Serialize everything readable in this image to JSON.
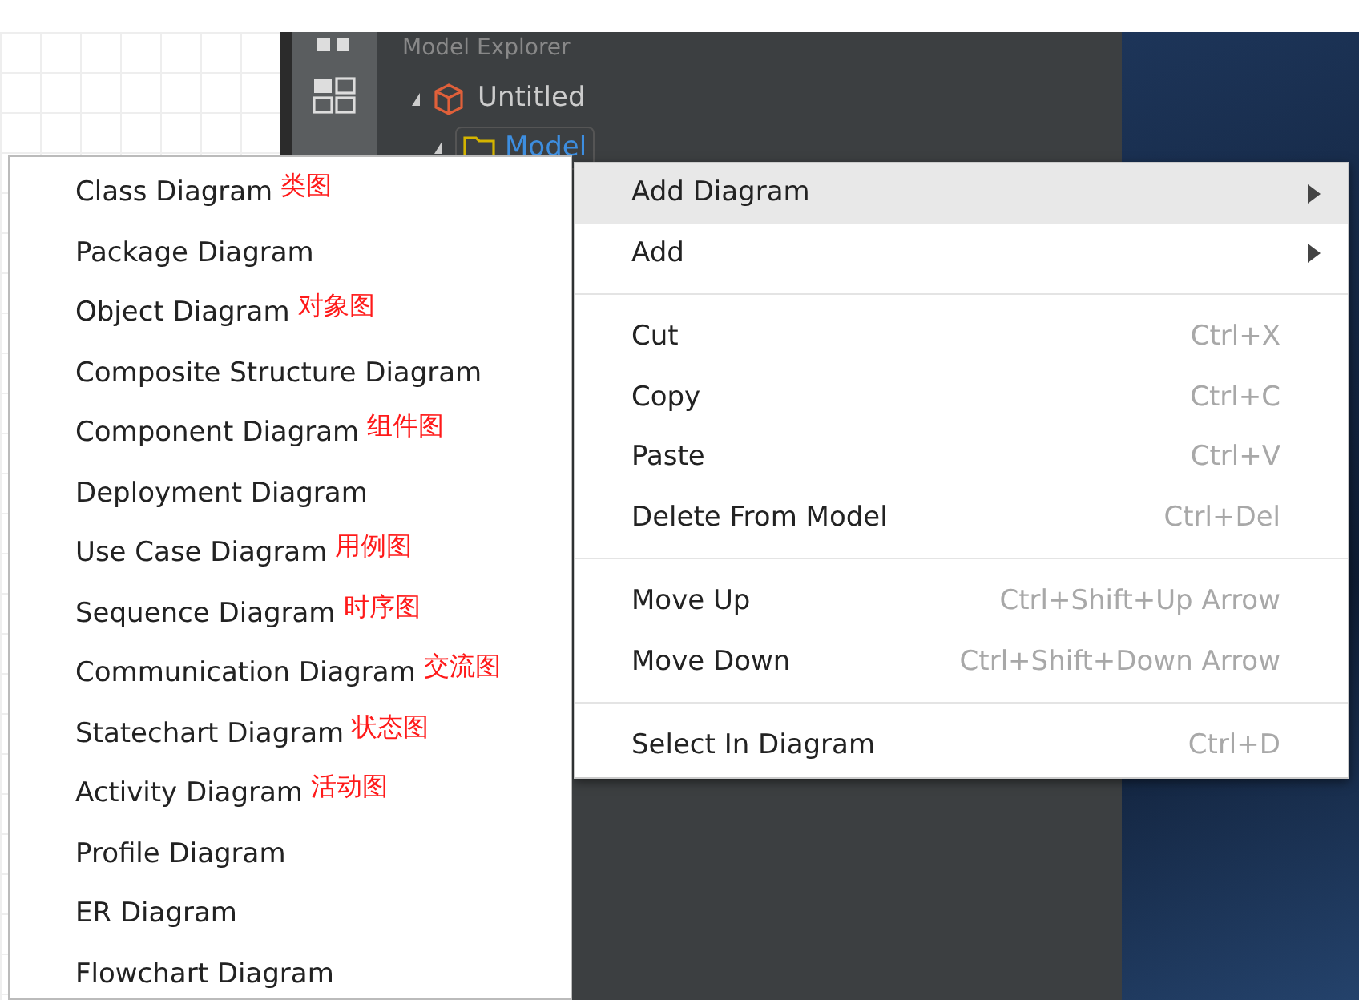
{
  "explorer": {
    "title": "Model Explorer",
    "tree": [
      {
        "label": "Untitled",
        "kind": "project",
        "expanded": true,
        "children": [
          {
            "label": "Model",
            "kind": "model",
            "expanded": true
          }
        ]
      }
    ]
  },
  "context_menu": {
    "items": [
      {
        "kind": "submenu",
        "label": "Add Diagram",
        "selected": true
      },
      {
        "kind": "submenu",
        "label": "Add",
        "selected": false
      },
      {
        "kind": "separator"
      },
      {
        "kind": "command",
        "label": "Cut",
        "shortcut": "Ctrl+X",
        "selected": false
      },
      {
        "kind": "command",
        "label": "Copy",
        "shortcut": "Ctrl+C",
        "selected": false
      },
      {
        "kind": "command",
        "label": "Paste",
        "shortcut": "Ctrl+V",
        "selected": false
      },
      {
        "kind": "command",
        "label": "Delete From Model",
        "shortcut": "Ctrl+Del",
        "selected": false
      },
      {
        "kind": "separator"
      },
      {
        "kind": "command",
        "label": "Move Up",
        "shortcut": "Ctrl+Shift+Up Arrow",
        "selected": false
      },
      {
        "kind": "command",
        "label": "Move Down",
        "shortcut": "Ctrl+Shift+Down Arrow",
        "selected": false
      },
      {
        "kind": "separator"
      },
      {
        "kind": "command",
        "label": "Select In Diagram",
        "shortcut": "Ctrl+D",
        "selected": false
      }
    ]
  },
  "submenu": {
    "items": [
      {
        "label": "Class Diagram",
        "note": "类图"
      },
      {
        "label": "Package Diagram"
      },
      {
        "label": "Object Diagram",
        "note": "对象图"
      },
      {
        "label": "Composite Structure Diagram"
      },
      {
        "label": "Component Diagram",
        "note": "组件图"
      },
      {
        "label": "Deployment Diagram"
      },
      {
        "label": "Use Case Diagram",
        "note": "用例图"
      },
      {
        "label": "Sequence Diagram",
        "note": "时序图"
      },
      {
        "label": "Communication Diagram",
        "note": "交流图"
      },
      {
        "label": "Statechart Diagram",
        "note": "状态图"
      },
      {
        "label": "Activity Diagram",
        "note": "活动图"
      },
      {
        "label": "Profile Diagram"
      },
      {
        "label": "ER Diagram"
      },
      {
        "label": "Flowchart Diagram"
      }
    ]
  }
}
